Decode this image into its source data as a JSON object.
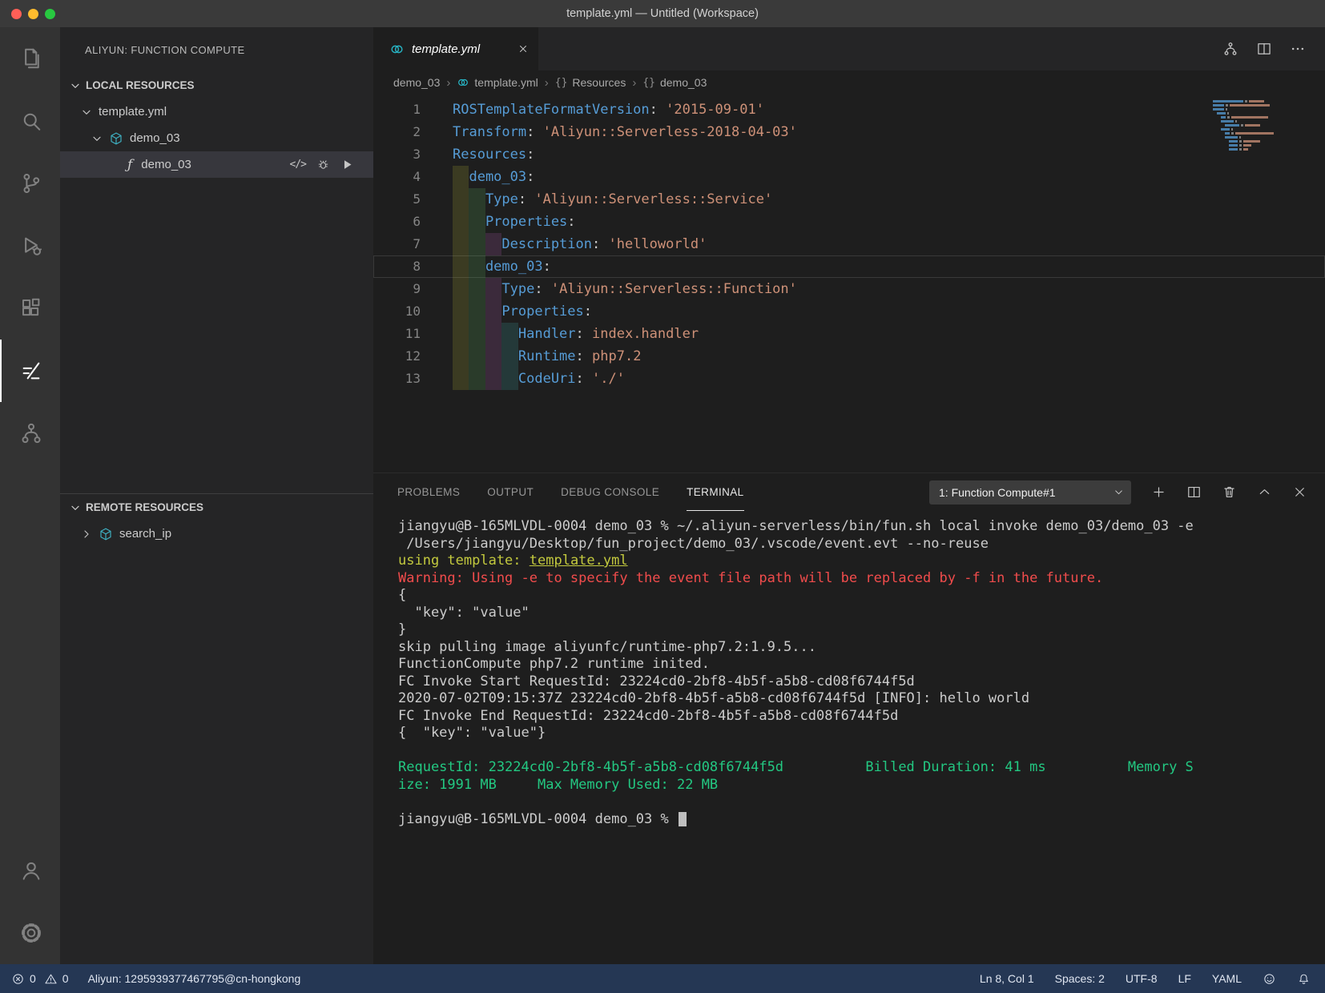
{
  "window": {
    "title": "template.yml — Untitled (Workspace)"
  },
  "colors": {
    "yaml_key": "#569cd6",
    "yaml_string": "#ce9178",
    "terminal_red": "#f14c4c",
    "terminal_yellow": "#c3c93e",
    "terminal_green": "#23c882",
    "aliyun_teal": "#27b4c4",
    "status_bar": "#253754"
  },
  "sidebar": {
    "title": "ALIYUN: FUNCTION COMPUTE",
    "function_icon": "ƒ",
    "code_action_icon": "</>",
    "local": {
      "header": "LOCAL RESOURCES",
      "template_row": "template.yml",
      "service_row": "demo_03",
      "function_row": "demo_03"
    },
    "remote": {
      "header": "REMOTE RESOURCES",
      "row": "search_ip"
    }
  },
  "editor": {
    "tab_label": "template.yml",
    "breadcrumb": {
      "separator": "›",
      "object_icon": "{}",
      "items": [
        "demo_03",
        "template.yml",
        "Resources",
        "demo_03"
      ]
    },
    "code": {
      "lines": [
        {
          "num": 1,
          "indent": 0,
          "tokens": [
            {
              "type": "key",
              "text": "ROSTemplateFormatVersion"
            },
            {
              "type": "punct",
              "text": ": "
            },
            {
              "type": "str",
              "text": "'2015-09-01'"
            }
          ]
        },
        {
          "num": 2,
          "indent": 0,
          "tokens": [
            {
              "type": "key",
              "text": "Transform"
            },
            {
              "type": "punct",
              "text": ": "
            },
            {
              "type": "str",
              "text": "'Aliyun::Serverless-2018-04-03'"
            }
          ]
        },
        {
          "num": 3,
          "indent": 0,
          "tokens": [
            {
              "type": "key",
              "text": "Resources"
            },
            {
              "type": "punct",
              "text": ":"
            }
          ]
        },
        {
          "num": 4,
          "indent": 1,
          "tokens": [
            {
              "type": "key",
              "text": "demo_03"
            },
            {
              "type": "punct",
              "text": ":"
            }
          ]
        },
        {
          "num": 5,
          "indent": 2,
          "tokens": [
            {
              "type": "key",
              "text": "Type"
            },
            {
              "type": "punct",
              "text": ": "
            },
            {
              "type": "str",
              "text": "'Aliyun::Serverless::Service'"
            }
          ]
        },
        {
          "num": 6,
          "indent": 2,
          "tokens": [
            {
              "type": "key",
              "text": "Properties"
            },
            {
              "type": "punct",
              "text": ":"
            }
          ]
        },
        {
          "num": 7,
          "indent": 3,
          "tokens": [
            {
              "type": "key",
              "text": "Description"
            },
            {
              "type": "punct",
              "text": ": "
            },
            {
              "type": "str",
              "text": "'helloworld'"
            }
          ]
        },
        {
          "num": 8,
          "indent": 2,
          "current": true,
          "tokens": [
            {
              "type": "key",
              "text": "demo_03"
            },
            {
              "type": "punct",
              "text": ":"
            }
          ]
        },
        {
          "num": 9,
          "indent": 3,
          "tokens": [
            {
              "type": "key",
              "text": "Type"
            },
            {
              "type": "punct",
              "text": ": "
            },
            {
              "type": "str",
              "text": "'Aliyun::Serverless::Function'"
            }
          ]
        },
        {
          "num": 10,
          "indent": 3,
          "tokens": [
            {
              "type": "key",
              "text": "Properties"
            },
            {
              "type": "punct",
              "text": ":"
            }
          ]
        },
        {
          "num": 11,
          "indent": 4,
          "tokens": [
            {
              "type": "key",
              "text": "Handler"
            },
            {
              "type": "punct",
              "text": ": "
            },
            {
              "type": "str",
              "text": "index.handler"
            }
          ]
        },
        {
          "num": 12,
          "indent": 4,
          "tokens": [
            {
              "type": "key",
              "text": "Runtime"
            },
            {
              "type": "punct",
              "text": ": "
            },
            {
              "type": "str",
              "text": "php7.2"
            }
          ]
        },
        {
          "num": 13,
          "indent": 4,
          "tokens": [
            {
              "type": "key",
              "text": "CodeUri"
            },
            {
              "type": "punct",
              "text": ": "
            },
            {
              "type": "str",
              "text": "'./'"
            }
          ]
        }
      ]
    }
  },
  "panel": {
    "tabs": [
      "PROBLEMS",
      "OUTPUT",
      "DEBUG CONSOLE",
      "TERMINAL"
    ],
    "active_tab": "TERMINAL",
    "terminal_select": "1: Function Compute#1",
    "terminal": {
      "lines": [
        {
          "color": "fg",
          "text": "jiangyu@B-165MLVDL-0004 demo_03 % ~/.aliyun-serverless/bin/fun.sh local invoke demo_03/demo_03 -e"
        },
        {
          "color": "fg",
          "text": " /Users/jiangyu/Desktop/fun_project/demo_03/.vscode/event.evt --no-reuse"
        },
        {
          "color": "yellow",
          "parts": [
            {
              "text": "using template: "
            },
            {
              "text": "template.yml",
              "underline": true
            }
          ]
        },
        {
          "color": "red",
          "text": "Warning: Using -e to specify the event file path will be replaced by -f in the future."
        },
        {
          "color": "fg",
          "text": "{"
        },
        {
          "color": "fg",
          "text": "  \"key\": \"value\""
        },
        {
          "color": "fg",
          "text": "}"
        },
        {
          "color": "fg",
          "text": "skip pulling image aliyunfc/runtime-php7.2:1.9.5..."
        },
        {
          "color": "fg",
          "text": "FunctionCompute php7.2 runtime inited."
        },
        {
          "color": "fg",
          "text": "FC Invoke Start RequestId: 23224cd0-2bf8-4b5f-a5b8-cd08f6744f5d"
        },
        {
          "color": "fg",
          "text": "2020-07-02T09:15:37Z 23224cd0-2bf8-4b5f-a5b8-cd08f6744f5d [INFO]: hello world"
        },
        {
          "color": "fg",
          "text": "FC Invoke End RequestId: 23224cd0-2bf8-4b5f-a5b8-cd08f6744f5d"
        },
        {
          "color": "fg",
          "text": "{  \"key\": \"value\"}"
        },
        {
          "color": "fg",
          "text": ""
        },
        {
          "color": "green",
          "text": "RequestId: 23224cd0-2bf8-4b5f-a5b8-cd08f6744f5d          Billed Duration: 41 ms          Memory S"
        },
        {
          "color": "green",
          "text": "ize: 1991 MB     Max Memory Used: 22 MB"
        },
        {
          "color": "fg",
          "text": ""
        },
        {
          "color": "fg",
          "text": "jiangyu@B-165MLVDL-0004 demo_03 % ",
          "cursor": true
        }
      ]
    }
  },
  "status_bar": {
    "errors": "0",
    "warnings": "0",
    "account": "Aliyun: 1295939377467795@cn-hongkong",
    "cursor_position": "Ln 8, Col 1",
    "indentation": "Spaces: 2",
    "encoding": "UTF-8",
    "eol": "LF",
    "language": "YAML"
  }
}
